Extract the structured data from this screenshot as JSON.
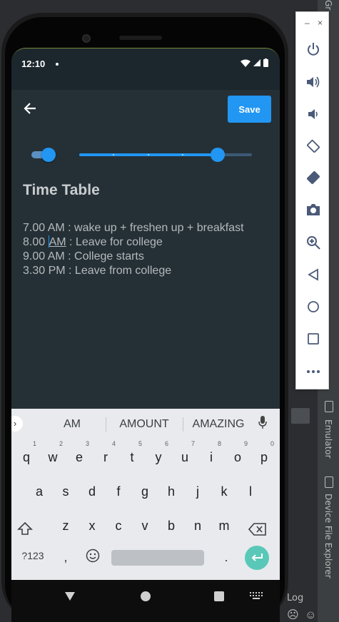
{
  "ide": {
    "right_tabs": [
      "Emulator",
      "Device File Explorer"
    ],
    "log_label": "Log",
    "top_tab_fragment": "Gr"
  },
  "emulator_panel": {
    "window_controls": [
      "–",
      "×"
    ],
    "icons": [
      "power-icon",
      "volume-up-icon",
      "volume-down-icon",
      "rotate-left-icon",
      "rotate-right-icon",
      "camera-icon",
      "zoom-icon",
      "back-icon",
      "home-icon",
      "overview-icon",
      "more-icon"
    ]
  },
  "status_bar": {
    "time": "12:10"
  },
  "app_bar": {
    "save_label": "Save"
  },
  "editor": {
    "toggle_on": true,
    "slider": {
      "value": 0.8,
      "steps": 5
    },
    "title": "Time Table",
    "lines": [
      "7.00 AM : wake up + freshen up + breakfast",
      "8.00 ",
      "AM",
      " : Leave for college",
      "9.00 AM : College starts",
      "3.30 PM : Leave from college"
    ]
  },
  "keyboard": {
    "suggestions": [
      "AM",
      "AMOUNT",
      "AMAZING"
    ],
    "row1": [
      "q",
      "w",
      "e",
      "r",
      "t",
      "y",
      "u",
      "i",
      "o",
      "p"
    ],
    "row1_hints": [
      "1",
      "2",
      "3",
      "4",
      "5",
      "6",
      "7",
      "8",
      "9",
      "0"
    ],
    "row2": [
      "a",
      "s",
      "d",
      "f",
      "g",
      "h",
      "j",
      "k",
      "l"
    ],
    "row3": [
      "z",
      "x",
      "c",
      "v",
      "b",
      "n",
      "m"
    ],
    "symbols_label": "?123",
    "comma": ",",
    "period": "."
  },
  "colors": {
    "accent": "#2196f3",
    "background": "#253036",
    "enter_key": "#5ac8b8"
  }
}
